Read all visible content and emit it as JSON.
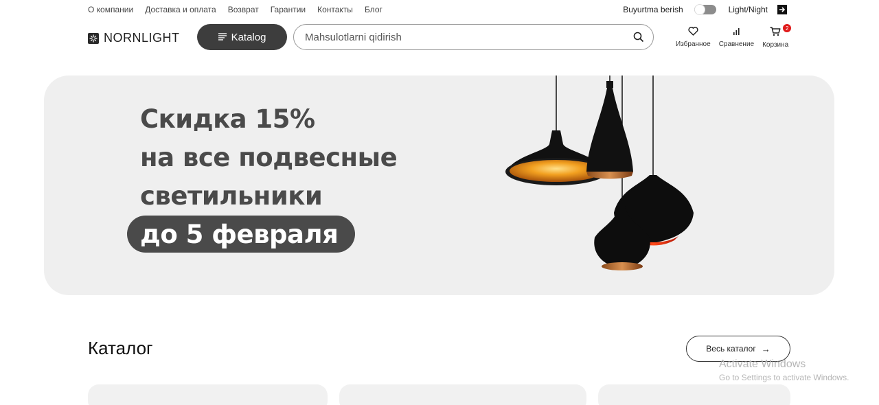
{
  "top_nav": {
    "links": [
      "О компании",
      "Доставка и оплата",
      "Возврат",
      "Гарантии",
      "Контакты",
      "Блог"
    ],
    "order_label": "Buyurtma berish",
    "theme_label": "Light/Night"
  },
  "header": {
    "logo_text": "NORNLIGHT",
    "catalog_button": "Katalog",
    "search_placeholder": "Mahsulotlarni qidirish",
    "favorites_label": "Избранное",
    "compare_label": "Сравнение",
    "cart_label": "Корзина",
    "cart_count": "2"
  },
  "banner": {
    "line1": "Скидка 15%",
    "line2": "на все подвесные",
    "line3": "светильники",
    "pill": "до 5 февраля"
  },
  "catalog": {
    "title": "Каталог",
    "all_button": "Весь каталог"
  },
  "watermark": {
    "title": "Activate Windows",
    "subtitle": "Go to Settings to activate Windows."
  },
  "colors": {
    "accent_dark": "#3d3d3d",
    "banner_bg": "#efefef",
    "badge": "#e01b1b"
  }
}
